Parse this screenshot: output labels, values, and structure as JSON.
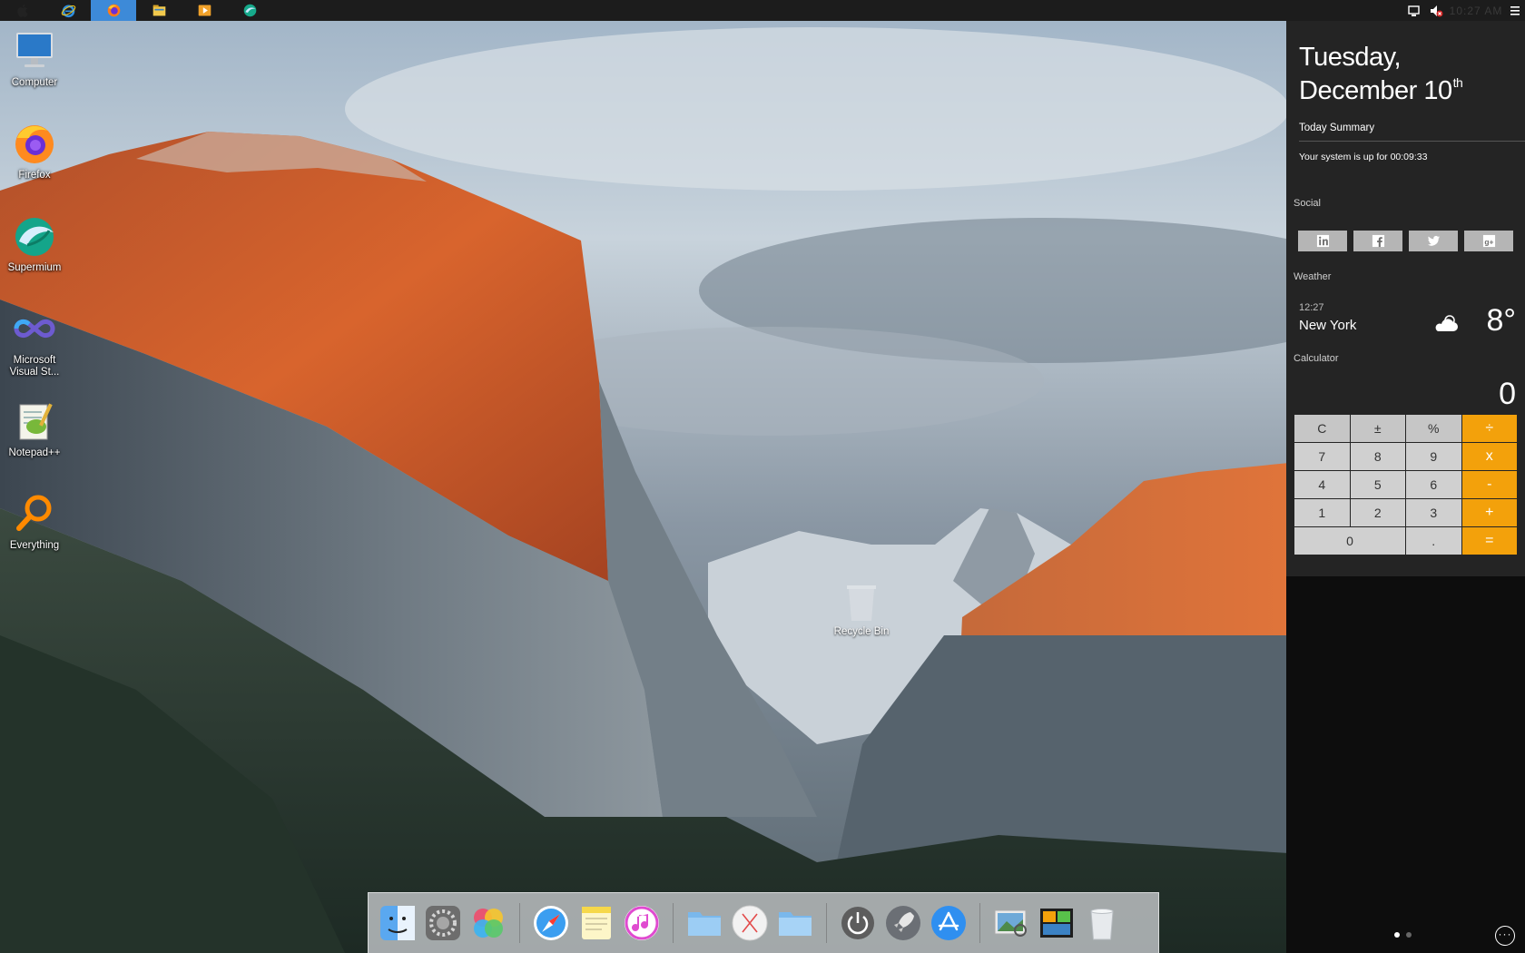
{
  "taskbar": {
    "start_icon": "apple-icon",
    "apps": [
      {
        "name": "internet-explorer-icon"
      },
      {
        "name": "firefox-icon",
        "active": true
      },
      {
        "name": "file-explorer-icon"
      },
      {
        "name": "media-player-icon"
      },
      {
        "name": "supermium-icon"
      }
    ],
    "tray": {
      "clock": "10:27 AM"
    }
  },
  "desktop": {
    "icons": [
      {
        "label": "Computer",
        "icon": "computer-icon"
      },
      {
        "label": "Firefox",
        "icon": "firefox-icon"
      },
      {
        "label": "Supermium",
        "icon": "supermium-icon"
      },
      {
        "label": "Microsoft Visual St...",
        "icon": "visual-studio-icon"
      },
      {
        "label": "Notepad++",
        "icon": "notepad-plus-plus-icon"
      },
      {
        "label": "Everything",
        "icon": "everything-search-icon"
      }
    ],
    "recycle_bin": "Recycle Bin"
  },
  "panel": {
    "day": "Tuesday,",
    "date": "December 10",
    "date_suffix": "th",
    "summary_title": "Today Summary",
    "uptime": "Your system is up for 00:09:33",
    "social_label": "Social",
    "social": [
      "linkedin-icon",
      "facebook-icon",
      "twitter-icon",
      "google-plus-icon"
    ],
    "weather_label": "Weather",
    "weather": {
      "time": "12:27",
      "city": "New York",
      "temp": "8°",
      "condition_icon": "cloud-sun-icon"
    },
    "calculator_label": "Calculator",
    "calculator": {
      "display": "0",
      "keys": [
        "C",
        "±",
        "%",
        "÷",
        "7",
        "8",
        "9",
        "x",
        "4",
        "5",
        "6",
        "-",
        "1",
        "2",
        "3",
        "+",
        "0",
        ".",
        "="
      ]
    },
    "page_dots": 2,
    "active_page": 1
  },
  "dock": {
    "items": [
      "finder-icon",
      "system-preferences-icon",
      "photos-icon",
      "safari-icon",
      "notes-icon",
      "itunes-icon",
      "folder-icon",
      "launchpad-x-icon",
      "folder-icon-2",
      "power-icon",
      "rocket-icon",
      "app-store-icon",
      "preview-icon",
      "desktop-widget-icon",
      "trash-icon"
    ]
  },
  "colors": {
    "accent_orange": "#f3a10b",
    "taskbar_bg": "#1c1c1c",
    "panel_bg": "#242424",
    "active_tab": "#3d8ad8"
  }
}
